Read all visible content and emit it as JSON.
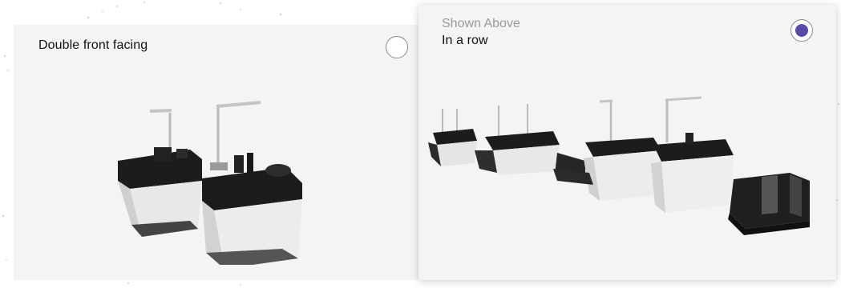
{
  "options": [
    {
      "id": "double-front-facing",
      "title": "Double front facing",
      "selected": false,
      "image": "double-front-facing-checkout-illustration"
    },
    {
      "id": "in-a-row",
      "subtitle": "Shown Above",
      "title": "In a row",
      "selected": true,
      "image": "in-a-row-checkout-illustration"
    }
  ],
  "colors": {
    "accent": "#5b4aa8",
    "card_background": "#f4f4f4",
    "subtitle_text": "#9a9a9a"
  }
}
